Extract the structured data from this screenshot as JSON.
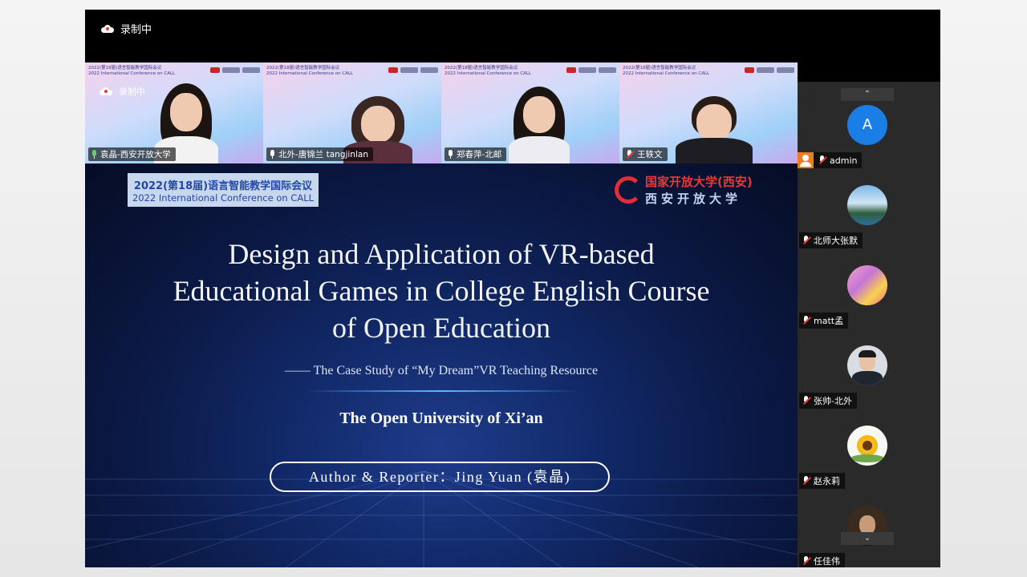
{
  "window": {
    "recording_label": "录制中"
  },
  "speakers": [
    {
      "name": "袁晶-西安开放大学",
      "mic": "active"
    },
    {
      "name": "北外-唐锦兰 tangjinlan",
      "mic": "on"
    },
    {
      "name": "郑春萍-北邮",
      "mic": "on"
    },
    {
      "name": "王轶文",
      "mic": "muted"
    }
  ],
  "tile_banner": {
    "line1": "2022(第18届)语言智能教学国际会议",
    "line2": "2022 International Conference on CALL"
  },
  "slide": {
    "conference_cn": "2022(第18届)语言智能教学国际会议",
    "conference_en": "2022 International Conference on CALL",
    "university_cn_1": "国家开放大学(西安)",
    "university_cn_2": "西安开放大学",
    "title_line1": "Design and Application of VR-based",
    "title_line2": "Educational Games in College English Course",
    "title_line3": "of Open Education",
    "subtitle": "—— The Case Study of “My Dream”VR Teaching Resource",
    "institution": "The Open University of Xi’an",
    "author": "Author & Reporter：Jing Yuan (袁晶)"
  },
  "participants": [
    {
      "name": "admin",
      "avatar_letter": "A",
      "avatar_color": "#1a7ee6",
      "host": true
    },
    {
      "name": "北师大张默",
      "avatar": "landscape-photo"
    },
    {
      "name": "matt孟",
      "avatar": "pink-cards-photo"
    },
    {
      "name": "张帅-北外",
      "avatar": "portrait-photo"
    },
    {
      "name": "赵永莉",
      "avatar": "sunflower-photo"
    },
    {
      "name": "任佳伟",
      "avatar": "portrait-photo-2"
    }
  ],
  "sidebar": {
    "scroll_up": "⌃",
    "scroll_down": "⌄"
  },
  "colors": {
    "accent_blue": "#1a7ee6",
    "host_orange": "#f07c20",
    "muted_red": "#e53935",
    "university_red": "#e53a3a"
  }
}
